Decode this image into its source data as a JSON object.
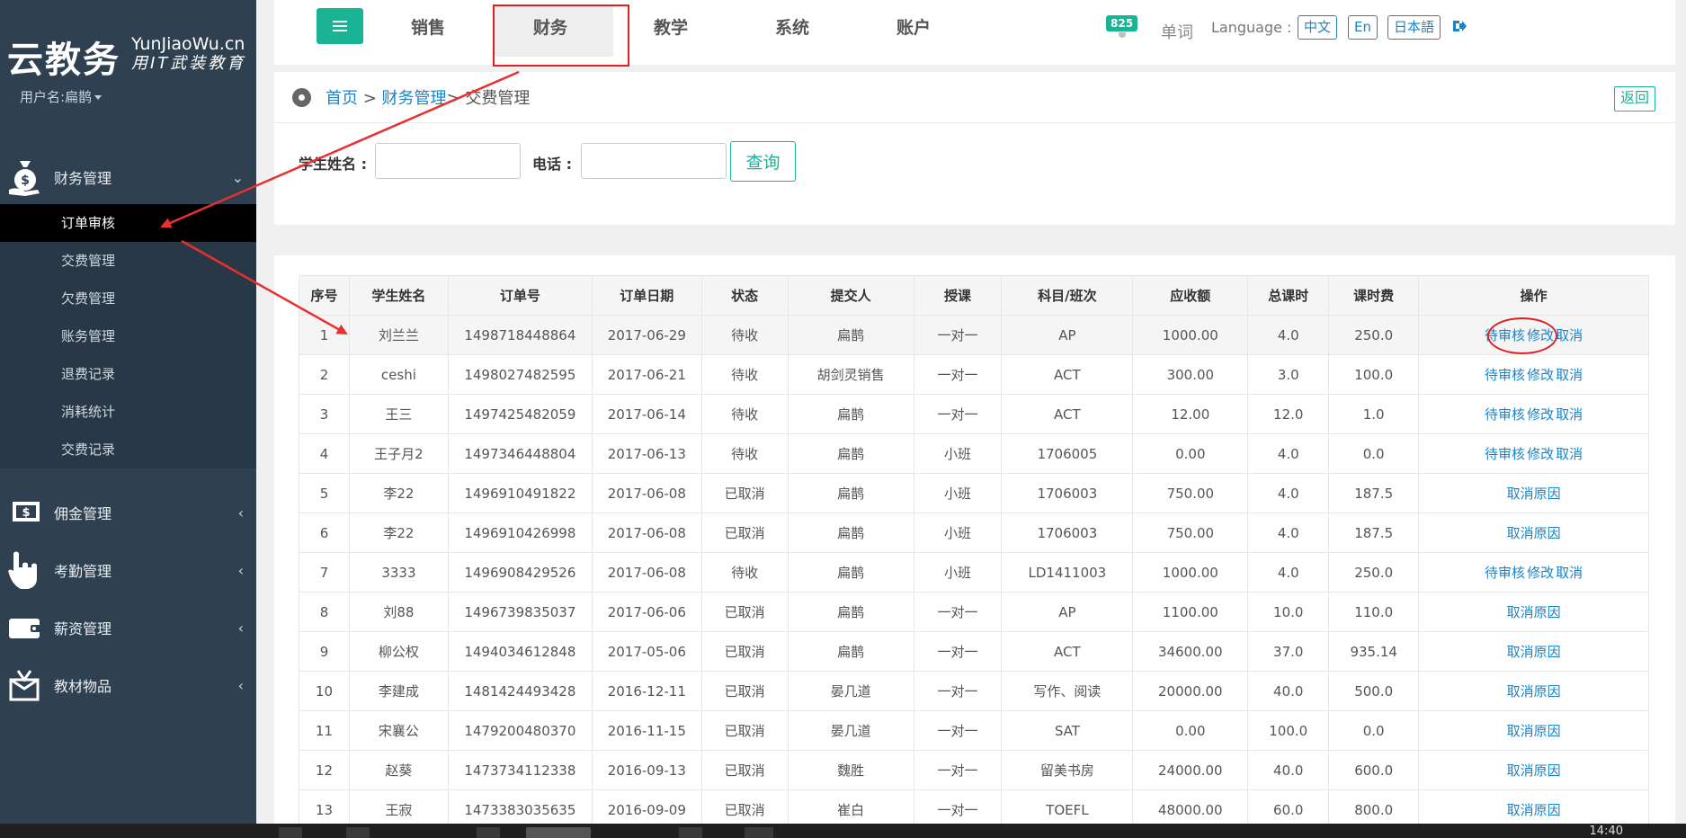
{
  "brand": {
    "logo_main": "云教务",
    "logo_en": "YunJiaoWu.cn",
    "logo_cn": "用IT武装教育",
    "username": "用户名:扁鹊"
  },
  "top_nav": {
    "items": [
      "销售",
      "财务",
      "教学",
      "系统",
      "账户"
    ],
    "active": "财务",
    "badge_count": "825",
    "word_link": "单词",
    "language_label": "Language :",
    "languages": [
      "中文",
      "En",
      "日本語"
    ]
  },
  "sidebar": {
    "groups": [
      {
        "label": "财务管理",
        "icon": "money-bag-icon",
        "expanded": true,
        "items": [
          "订单审核",
          "交费管理",
          "欠费管理",
          "账务管理",
          "退费记录",
          "消耗统计",
          "交费记录"
        ],
        "active_item": "订单审核"
      },
      {
        "label": "佣金管理",
        "icon": "dollar-bill-icon",
        "expanded": false
      },
      {
        "label": "考勤管理",
        "icon": "hand-pointer-icon",
        "expanded": false
      },
      {
        "label": "薪资管理",
        "icon": "wallet-icon",
        "expanded": false
      },
      {
        "label": "教材物品",
        "icon": "gift-box-icon",
        "expanded": false
      }
    ]
  },
  "breadcrumb": {
    "home": "首页",
    "sep1": " > ",
    "section": "财务管理",
    "sep2": "> ",
    "current": "交费管理"
  },
  "back_label": "返回",
  "search": {
    "student_label": "学生姓名 :",
    "student_value": "",
    "phone_label": "电话 :",
    "phone_value": "",
    "query_label": "查询"
  },
  "table": {
    "headers": [
      "序号",
      "学生姓名",
      "订单号",
      "订单日期",
      "状态",
      "提交人",
      "授课",
      "科目/班次",
      "应收额",
      "总课时",
      "课时费",
      "操作"
    ],
    "rows": [
      [
        "1",
        "刘兰兰",
        "1498718448864",
        "2017-06-29",
        "待收",
        "扁鹊",
        "一对一",
        "AP",
        "1000.00",
        "4.0",
        "250.0",
        [
          "待审核",
          "修改",
          "取消"
        ]
      ],
      [
        "2",
        "ceshi",
        "1498027482595",
        "2017-06-21",
        "待收",
        "胡剑灵销售",
        "一对一",
        "ACT",
        "300.00",
        "3.0",
        "100.0",
        [
          "待审核",
          "修改",
          "取消"
        ]
      ],
      [
        "3",
        "王三",
        "1497425482059",
        "2017-06-14",
        "待收",
        "扁鹊",
        "一对一",
        "ACT",
        "12.00",
        "12.0",
        "1.0",
        [
          "待审核",
          "修改",
          "取消"
        ]
      ],
      [
        "4",
        "王子月2",
        "1497346448804",
        "2017-06-13",
        "待收",
        "扁鹊",
        "小班",
        "1706005",
        "0.00",
        "4.0",
        "0.0",
        [
          "待审核",
          "修改",
          "取消"
        ]
      ],
      [
        "5",
        "李22",
        "1496910491822",
        "2017-06-08",
        "已取消",
        "扁鹊",
        "小班",
        "1706003",
        "750.00",
        "4.0",
        "187.5",
        [
          "取消原因"
        ]
      ],
      [
        "6",
        "李22",
        "1496910426998",
        "2017-06-08",
        "已取消",
        "扁鹊",
        "小班",
        "1706003",
        "750.00",
        "4.0",
        "187.5",
        [
          "取消原因"
        ]
      ],
      [
        "7",
        "3333",
        "1496908429526",
        "2017-06-08",
        "待收",
        "扁鹊",
        "小班",
        "LD1411003",
        "1000.00",
        "4.0",
        "250.0",
        [
          "待审核",
          "修改",
          "取消"
        ]
      ],
      [
        "8",
        "刘88",
        "1496739835037",
        "2017-06-06",
        "已取消",
        "扁鹊",
        "一对一",
        "AP",
        "1100.00",
        "10.0",
        "110.0",
        [
          "取消原因"
        ]
      ],
      [
        "9",
        "柳公权",
        "1494034612848",
        "2017-05-06",
        "已取消",
        "扁鹊",
        "一对一",
        "ACT",
        "34600.00",
        "37.0",
        "935.14",
        [
          "取消原因"
        ]
      ],
      [
        "10",
        "李建成",
        "1481424493428",
        "2016-12-11",
        "已取消",
        "晏几道",
        "一对一",
        "写作、阅读",
        "20000.00",
        "40.0",
        "500.0",
        [
          "取消原因"
        ]
      ],
      [
        "11",
        "宋襄公",
        "1479200480370",
        "2016-11-15",
        "已取消",
        "晏几道",
        "一对一",
        "SAT",
        "0.00",
        "100.0",
        "0.0",
        [
          "取消原因"
        ]
      ],
      [
        "12",
        "赵葵",
        "1473734112338",
        "2016-09-13",
        "已取消",
        "魏胜",
        "一对一",
        "留美书房",
        "24000.00",
        "40.0",
        "600.0",
        [
          "取消原因"
        ]
      ],
      [
        "13",
        "王寂",
        "1473383035635",
        "2016-09-09",
        "已取消",
        "崔白",
        "一对一",
        "TOEFL",
        "48000.00",
        "60.0",
        "800.0",
        [
          "取消原因"
        ]
      ]
    ]
  },
  "taskbar": {
    "clock": "14:40"
  },
  "colors": {
    "accent": "#1ab394",
    "link": "#1c84c6",
    "sidebar": "#2f4050",
    "annotation": "#e02020"
  }
}
